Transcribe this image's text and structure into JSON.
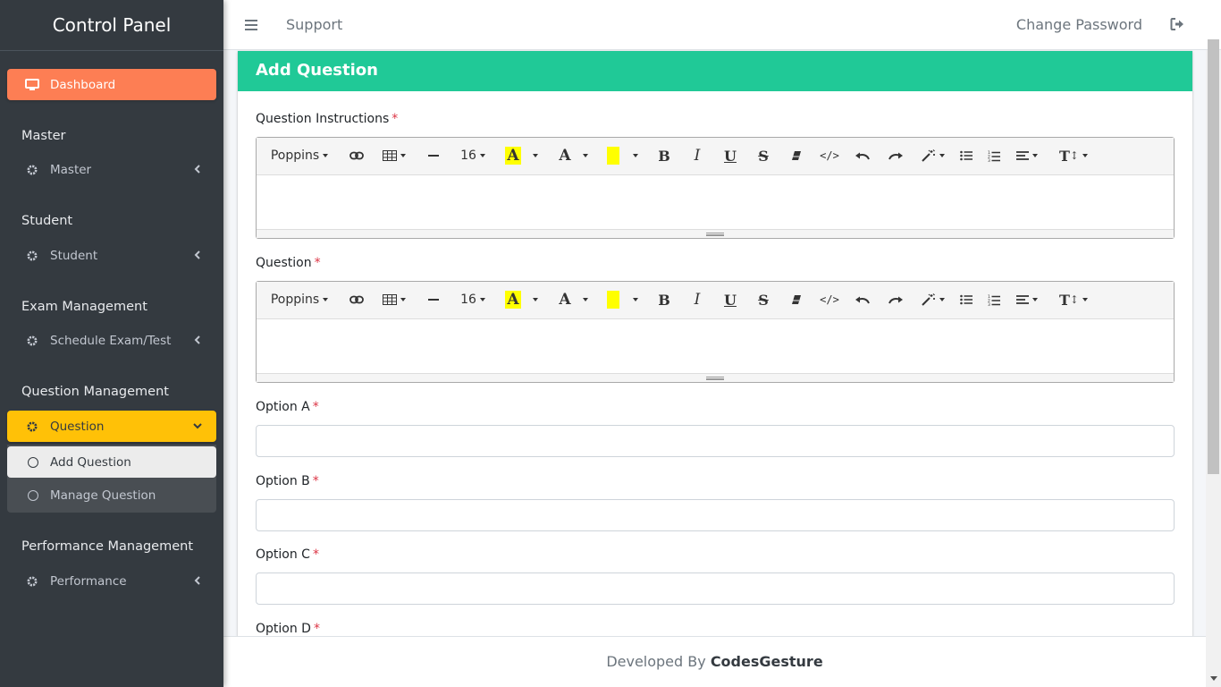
{
  "sidebar": {
    "brand": "Control Panel",
    "dashboard": {
      "label": "Dashboard",
      "icon": "monitor-icon"
    },
    "sections": [
      {
        "header": "Master",
        "item": {
          "label": "Master",
          "icon": "gear-icon"
        }
      },
      {
        "header": "Student",
        "item": {
          "label": "Student",
          "icon": "gear-icon"
        }
      },
      {
        "header": "Exam Management",
        "item": {
          "label": "Schedule Exam/Test",
          "icon": "gear-icon"
        }
      },
      {
        "header": "Question Management",
        "item": {
          "label": "Question",
          "icon": "gear-icon"
        }
      },
      {
        "header": "Performance Management",
        "item": {
          "label": "Performance",
          "icon": "gear-icon"
        }
      }
    ],
    "question_submenu": [
      {
        "label": "Add Question",
        "selected": true
      },
      {
        "label": "Manage Question",
        "selected": false
      }
    ]
  },
  "navbar": {
    "support": "Support",
    "change_password": "Change Password"
  },
  "card": {
    "title": "Add Question"
  },
  "form": {
    "instructions_label": "Question Instructions",
    "question_label": "Question",
    "option_a_label": "Option A",
    "option_b_label": "Option B",
    "option_c_label": "Option C",
    "option_d_label": "Option D",
    "required_mark": "*"
  },
  "editor_toolbar": {
    "font_family": "Poppins",
    "font_size": "16"
  },
  "footer": {
    "prefix": "Developed By",
    "brand": "CodesGesture"
  },
  "colors": {
    "sidebar_bg": "#343a40",
    "dashboard_bg": "#fd7e54",
    "active_bg": "#ffc107",
    "card_header_bg": "#20c997",
    "required": "#dc3545"
  }
}
